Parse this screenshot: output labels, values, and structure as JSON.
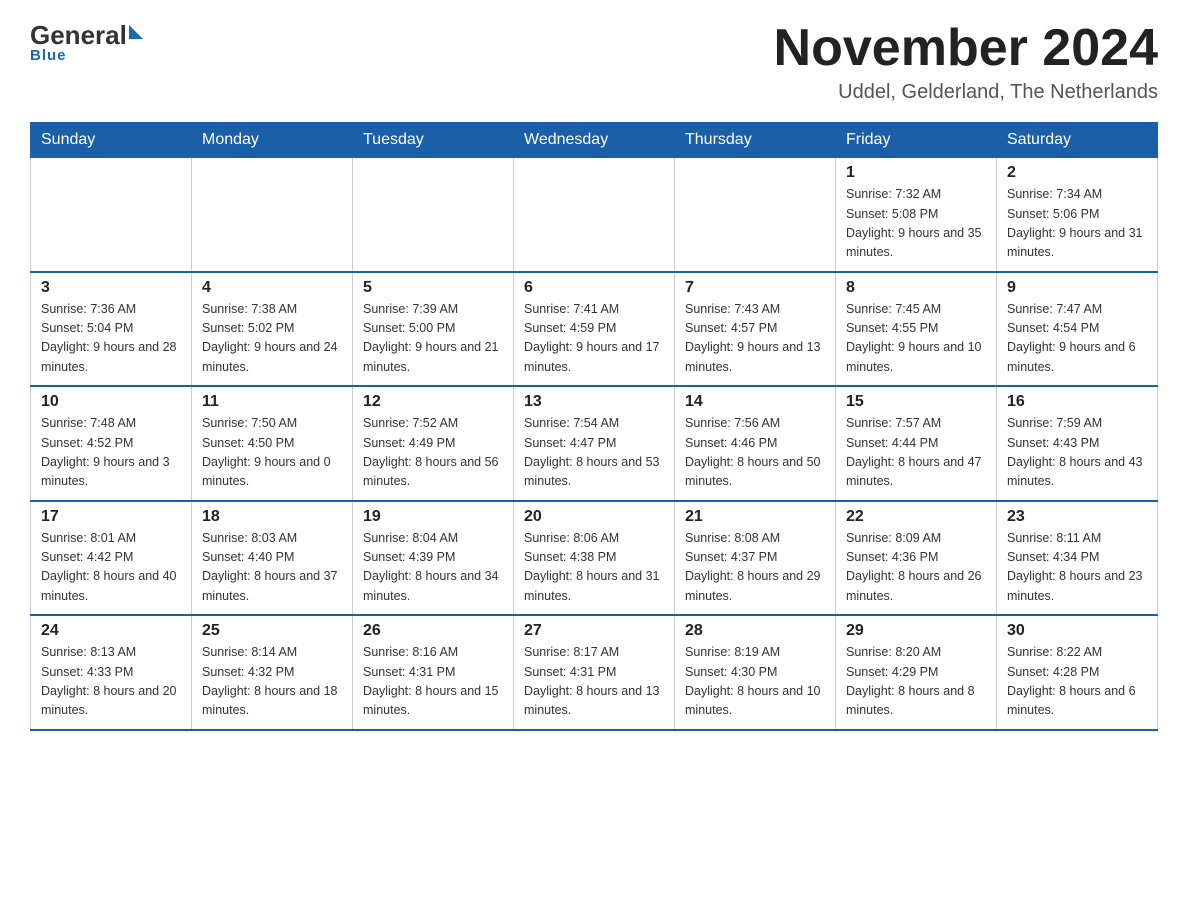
{
  "header": {
    "logo_general": "General",
    "logo_blue": "Blue",
    "month_title": "November 2024",
    "location": "Uddel, Gelderland, The Netherlands"
  },
  "days_of_week": [
    "Sunday",
    "Monday",
    "Tuesday",
    "Wednesday",
    "Thursday",
    "Friday",
    "Saturday"
  ],
  "weeks": [
    [
      {
        "day": "",
        "info": ""
      },
      {
        "day": "",
        "info": ""
      },
      {
        "day": "",
        "info": ""
      },
      {
        "day": "",
        "info": ""
      },
      {
        "day": "",
        "info": ""
      },
      {
        "day": "1",
        "info": "Sunrise: 7:32 AM\nSunset: 5:08 PM\nDaylight: 9 hours\nand 35 minutes."
      },
      {
        "day": "2",
        "info": "Sunrise: 7:34 AM\nSunset: 5:06 PM\nDaylight: 9 hours\nand 31 minutes."
      }
    ],
    [
      {
        "day": "3",
        "info": "Sunrise: 7:36 AM\nSunset: 5:04 PM\nDaylight: 9 hours\nand 28 minutes."
      },
      {
        "day": "4",
        "info": "Sunrise: 7:38 AM\nSunset: 5:02 PM\nDaylight: 9 hours\nand 24 minutes."
      },
      {
        "day": "5",
        "info": "Sunrise: 7:39 AM\nSunset: 5:00 PM\nDaylight: 9 hours\nand 21 minutes."
      },
      {
        "day": "6",
        "info": "Sunrise: 7:41 AM\nSunset: 4:59 PM\nDaylight: 9 hours\nand 17 minutes."
      },
      {
        "day": "7",
        "info": "Sunrise: 7:43 AM\nSunset: 4:57 PM\nDaylight: 9 hours\nand 13 minutes."
      },
      {
        "day": "8",
        "info": "Sunrise: 7:45 AM\nSunset: 4:55 PM\nDaylight: 9 hours\nand 10 minutes."
      },
      {
        "day": "9",
        "info": "Sunrise: 7:47 AM\nSunset: 4:54 PM\nDaylight: 9 hours\nand 6 minutes."
      }
    ],
    [
      {
        "day": "10",
        "info": "Sunrise: 7:48 AM\nSunset: 4:52 PM\nDaylight: 9 hours\nand 3 minutes."
      },
      {
        "day": "11",
        "info": "Sunrise: 7:50 AM\nSunset: 4:50 PM\nDaylight: 9 hours\nand 0 minutes."
      },
      {
        "day": "12",
        "info": "Sunrise: 7:52 AM\nSunset: 4:49 PM\nDaylight: 8 hours\nand 56 minutes."
      },
      {
        "day": "13",
        "info": "Sunrise: 7:54 AM\nSunset: 4:47 PM\nDaylight: 8 hours\nand 53 minutes."
      },
      {
        "day": "14",
        "info": "Sunrise: 7:56 AM\nSunset: 4:46 PM\nDaylight: 8 hours\nand 50 minutes."
      },
      {
        "day": "15",
        "info": "Sunrise: 7:57 AM\nSunset: 4:44 PM\nDaylight: 8 hours\nand 47 minutes."
      },
      {
        "day": "16",
        "info": "Sunrise: 7:59 AM\nSunset: 4:43 PM\nDaylight: 8 hours\nand 43 minutes."
      }
    ],
    [
      {
        "day": "17",
        "info": "Sunrise: 8:01 AM\nSunset: 4:42 PM\nDaylight: 8 hours\nand 40 minutes."
      },
      {
        "day": "18",
        "info": "Sunrise: 8:03 AM\nSunset: 4:40 PM\nDaylight: 8 hours\nand 37 minutes."
      },
      {
        "day": "19",
        "info": "Sunrise: 8:04 AM\nSunset: 4:39 PM\nDaylight: 8 hours\nand 34 minutes."
      },
      {
        "day": "20",
        "info": "Sunrise: 8:06 AM\nSunset: 4:38 PM\nDaylight: 8 hours\nand 31 minutes."
      },
      {
        "day": "21",
        "info": "Sunrise: 8:08 AM\nSunset: 4:37 PM\nDaylight: 8 hours\nand 29 minutes."
      },
      {
        "day": "22",
        "info": "Sunrise: 8:09 AM\nSunset: 4:36 PM\nDaylight: 8 hours\nand 26 minutes."
      },
      {
        "day": "23",
        "info": "Sunrise: 8:11 AM\nSunset: 4:34 PM\nDaylight: 8 hours\nand 23 minutes."
      }
    ],
    [
      {
        "day": "24",
        "info": "Sunrise: 8:13 AM\nSunset: 4:33 PM\nDaylight: 8 hours\nand 20 minutes."
      },
      {
        "day": "25",
        "info": "Sunrise: 8:14 AM\nSunset: 4:32 PM\nDaylight: 8 hours\nand 18 minutes."
      },
      {
        "day": "26",
        "info": "Sunrise: 8:16 AM\nSunset: 4:31 PM\nDaylight: 8 hours\nand 15 minutes."
      },
      {
        "day": "27",
        "info": "Sunrise: 8:17 AM\nSunset: 4:31 PM\nDaylight: 8 hours\nand 13 minutes."
      },
      {
        "day": "28",
        "info": "Sunrise: 8:19 AM\nSunset: 4:30 PM\nDaylight: 8 hours\nand 10 minutes."
      },
      {
        "day": "29",
        "info": "Sunrise: 8:20 AM\nSunset: 4:29 PM\nDaylight: 8 hours\nand 8 minutes."
      },
      {
        "day": "30",
        "info": "Sunrise: 8:22 AM\nSunset: 4:28 PM\nDaylight: 8 hours\nand 6 minutes."
      }
    ]
  ]
}
